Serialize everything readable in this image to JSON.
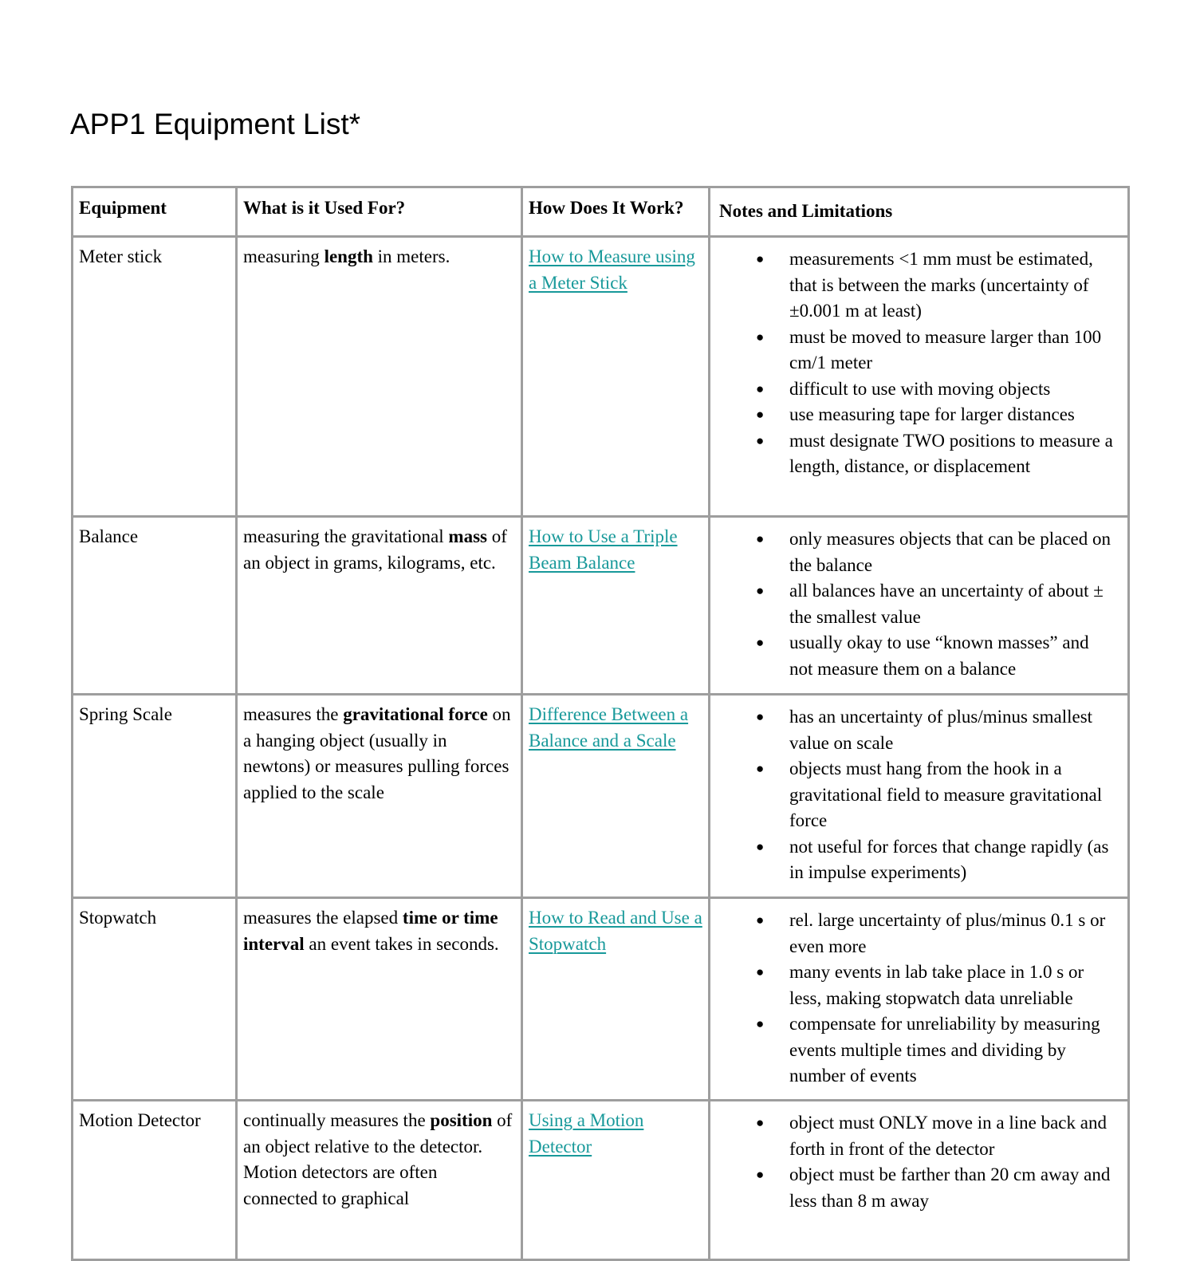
{
  "document": {
    "title": "APP1 Equipment List*"
  },
  "table": {
    "headers": [
      "Equipment",
      "What is it Used For?",
      "How Does It Work?",
      "Notes and Limitations"
    ],
    "link_color": "#18999a",
    "border_color": "#9e9e9e",
    "bullet_glyph": "●",
    "rows": [
      {
        "equipment": "Meter stick",
        "used_for": {
          "pre": "measuring ",
          "bold": "length",
          "post": " in meters."
        },
        "how_link": "How to Measure using a Meter Stick",
        "notes": [
          "measurements <1 mm must be estimated, that is between the marks (uncertainty of ±0.001 m at least)",
          "must be moved to measure larger than 100 cm/1 meter",
          "difficult to use with moving objects",
          "use measuring tape for larger distances",
          "must designate TWO positions to measure a length, distance, or displacement"
        ]
      },
      {
        "equipment": "Balance",
        "used_for": {
          "pre": "measuring the gravitational ",
          "bold": "mass",
          "post": " of an object in grams, kilograms, etc."
        },
        "how_link": "How to Use a Triple Beam Balance",
        "notes": [
          "only measures objects that can be placed on the balance",
          "all balances have an uncertainty of about ± the smallest value",
          "usually okay to use “known masses” and not measure them on a balance"
        ]
      },
      {
        "equipment": "Spring Scale",
        "used_for": {
          "pre": "measures the ",
          "bold": "gravitational force",
          "post": " on a hanging object (usually in newtons) or measures pulling forces applied to the scale"
        },
        "how_link": "Difference Between a Balance and a Scale",
        "notes": [
          "has an uncertainty of plus/minus smallest value on scale",
          "objects must hang from the hook in a gravitational field to measure gravitational force",
          "not useful for forces that change rapidly (as in impulse experiments)"
        ]
      },
      {
        "equipment": "Stopwatch",
        "used_for": {
          "pre": "measures the elapsed ",
          "bold": "time or time interval",
          "post": " an event takes in seconds."
        },
        "how_link": "How to Read and Use a Stopwatch",
        "notes": [
          "rel. large uncertainty of plus/minus 0.1 s or even more",
          "many events in lab take place in 1.0 s or less, making stopwatch data unreliable",
          "compensate for unreliability by measuring events multiple times and dividing by number of events"
        ]
      },
      {
        "equipment": "Motion Detector",
        "used_for": {
          "pre": "continually measures the ",
          "bold": "position",
          "post": " of an object relative to the detector. Motion detectors are often connected to graphical"
        },
        "how_link": "Using a Motion Detector",
        "notes": [
          "object must ONLY move in a line back and forth in front of the detector",
          "object must be farther than 20 cm away and less than 8 m away"
        ]
      }
    ]
  }
}
